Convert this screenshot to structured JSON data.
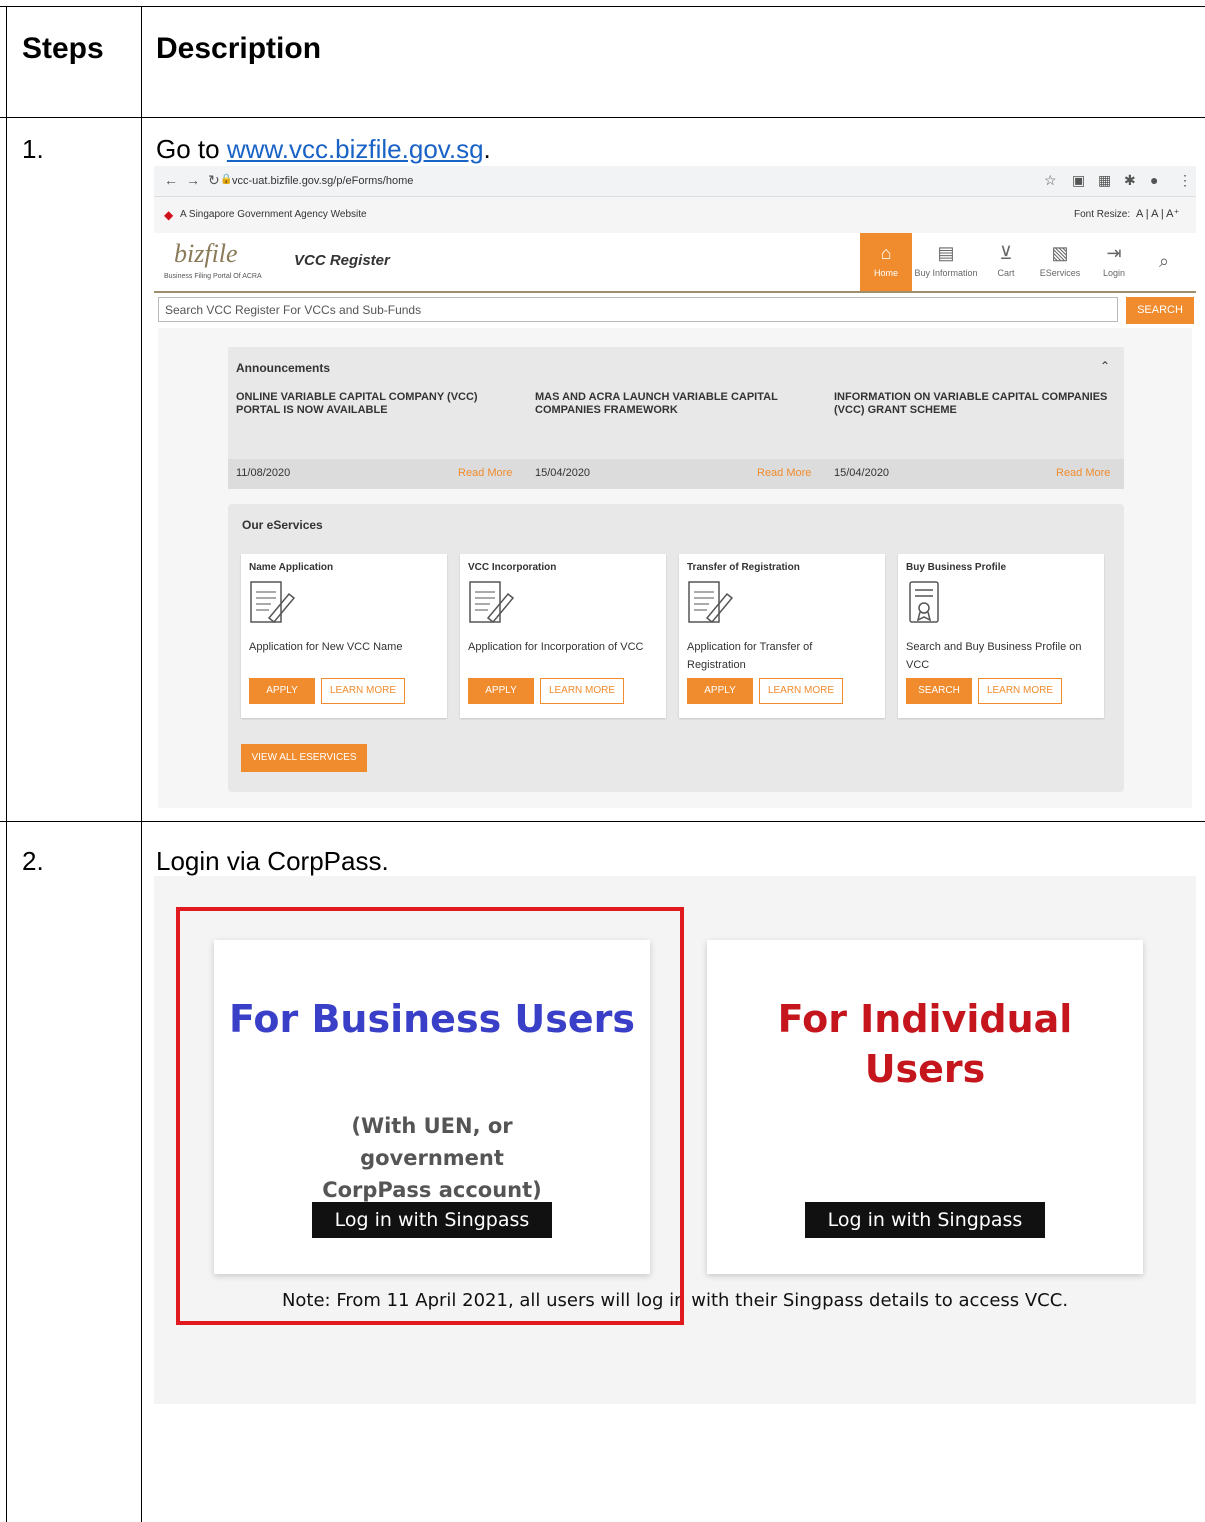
{
  "table": {
    "header_steps": "Steps",
    "header_description": "Description",
    "rows": [
      {
        "step": "1.",
        "desc_prefix": "Go to ",
        "link": "www.vcc.bizfile.gov.sg",
        "desc_suffix": "."
      },
      {
        "step": "2.",
        "desc": "Login via CorpPass."
      }
    ]
  },
  "shot1": {
    "url": "vcc-uat.bizfile.gov.sg/p/eForms/home",
    "gov_banner": "A Singapore Government Agency Website",
    "font_resize": "Font Resize:",
    "logo_text": "bizfile",
    "logo_sub": "Business Filing Portal Of ACRA",
    "site_title": "VCC Register",
    "nav": [
      "Home",
      "Buy Information",
      "Cart",
      "EServices",
      "Login"
    ],
    "search_placeholder": "Search VCC Register For VCCs and Sub-Funds",
    "search_button": "SEARCH",
    "announcements": {
      "title": "Announcements",
      "items": [
        {
          "text": "ONLINE VARIABLE CAPITAL COMPANY (VCC) PORTAL IS NOW AVAILABLE",
          "date": "11/08/2020",
          "read": "Read More"
        },
        {
          "text": "MAS AND ACRA LAUNCH VARIABLE CAPITAL COMPANIES FRAMEWORK",
          "date": "15/04/2020",
          "read": "Read More"
        },
        {
          "text": "INFORMATION ON VARIABLE CAPITAL COMPANIES (VCC) GRANT SCHEME",
          "date": "15/04/2020",
          "read": "Read More"
        }
      ]
    },
    "eservices": {
      "title": "Our eServices",
      "cards": [
        {
          "title": "Name Application",
          "desc": "Application for New VCC Name",
          "primary": "APPLY",
          "secondary": "LEARN MORE"
        },
        {
          "title": "VCC Incorporation",
          "desc": "Application for Incorporation of VCC",
          "primary": "APPLY",
          "secondary": "LEARN MORE"
        },
        {
          "title": "Transfer of Registration",
          "desc": "Application for Transfer of Registration",
          "primary": "APPLY",
          "secondary": "LEARN MORE"
        },
        {
          "title": "Buy Business Profile",
          "desc": "Search and Buy Business Profile on VCC",
          "primary": "SEARCH",
          "secondary": "LEARN MORE"
        }
      ],
      "view_all": "VIEW ALL ESERVICES"
    }
  },
  "shot2": {
    "business": {
      "title": "For Business Users",
      "subtitle": "(With UEN, or government CorpPass account)",
      "button": "Log in with Singpass",
      "color": "#3a3fc8"
    },
    "individual": {
      "title": "For Individual Users",
      "button": "Log in with Singpass",
      "color": "#c4161c"
    },
    "note": "Note: From 11 April 2021, all users will log in with their Singpass details to access VCC.",
    "highlight_color": "#e0191f"
  }
}
